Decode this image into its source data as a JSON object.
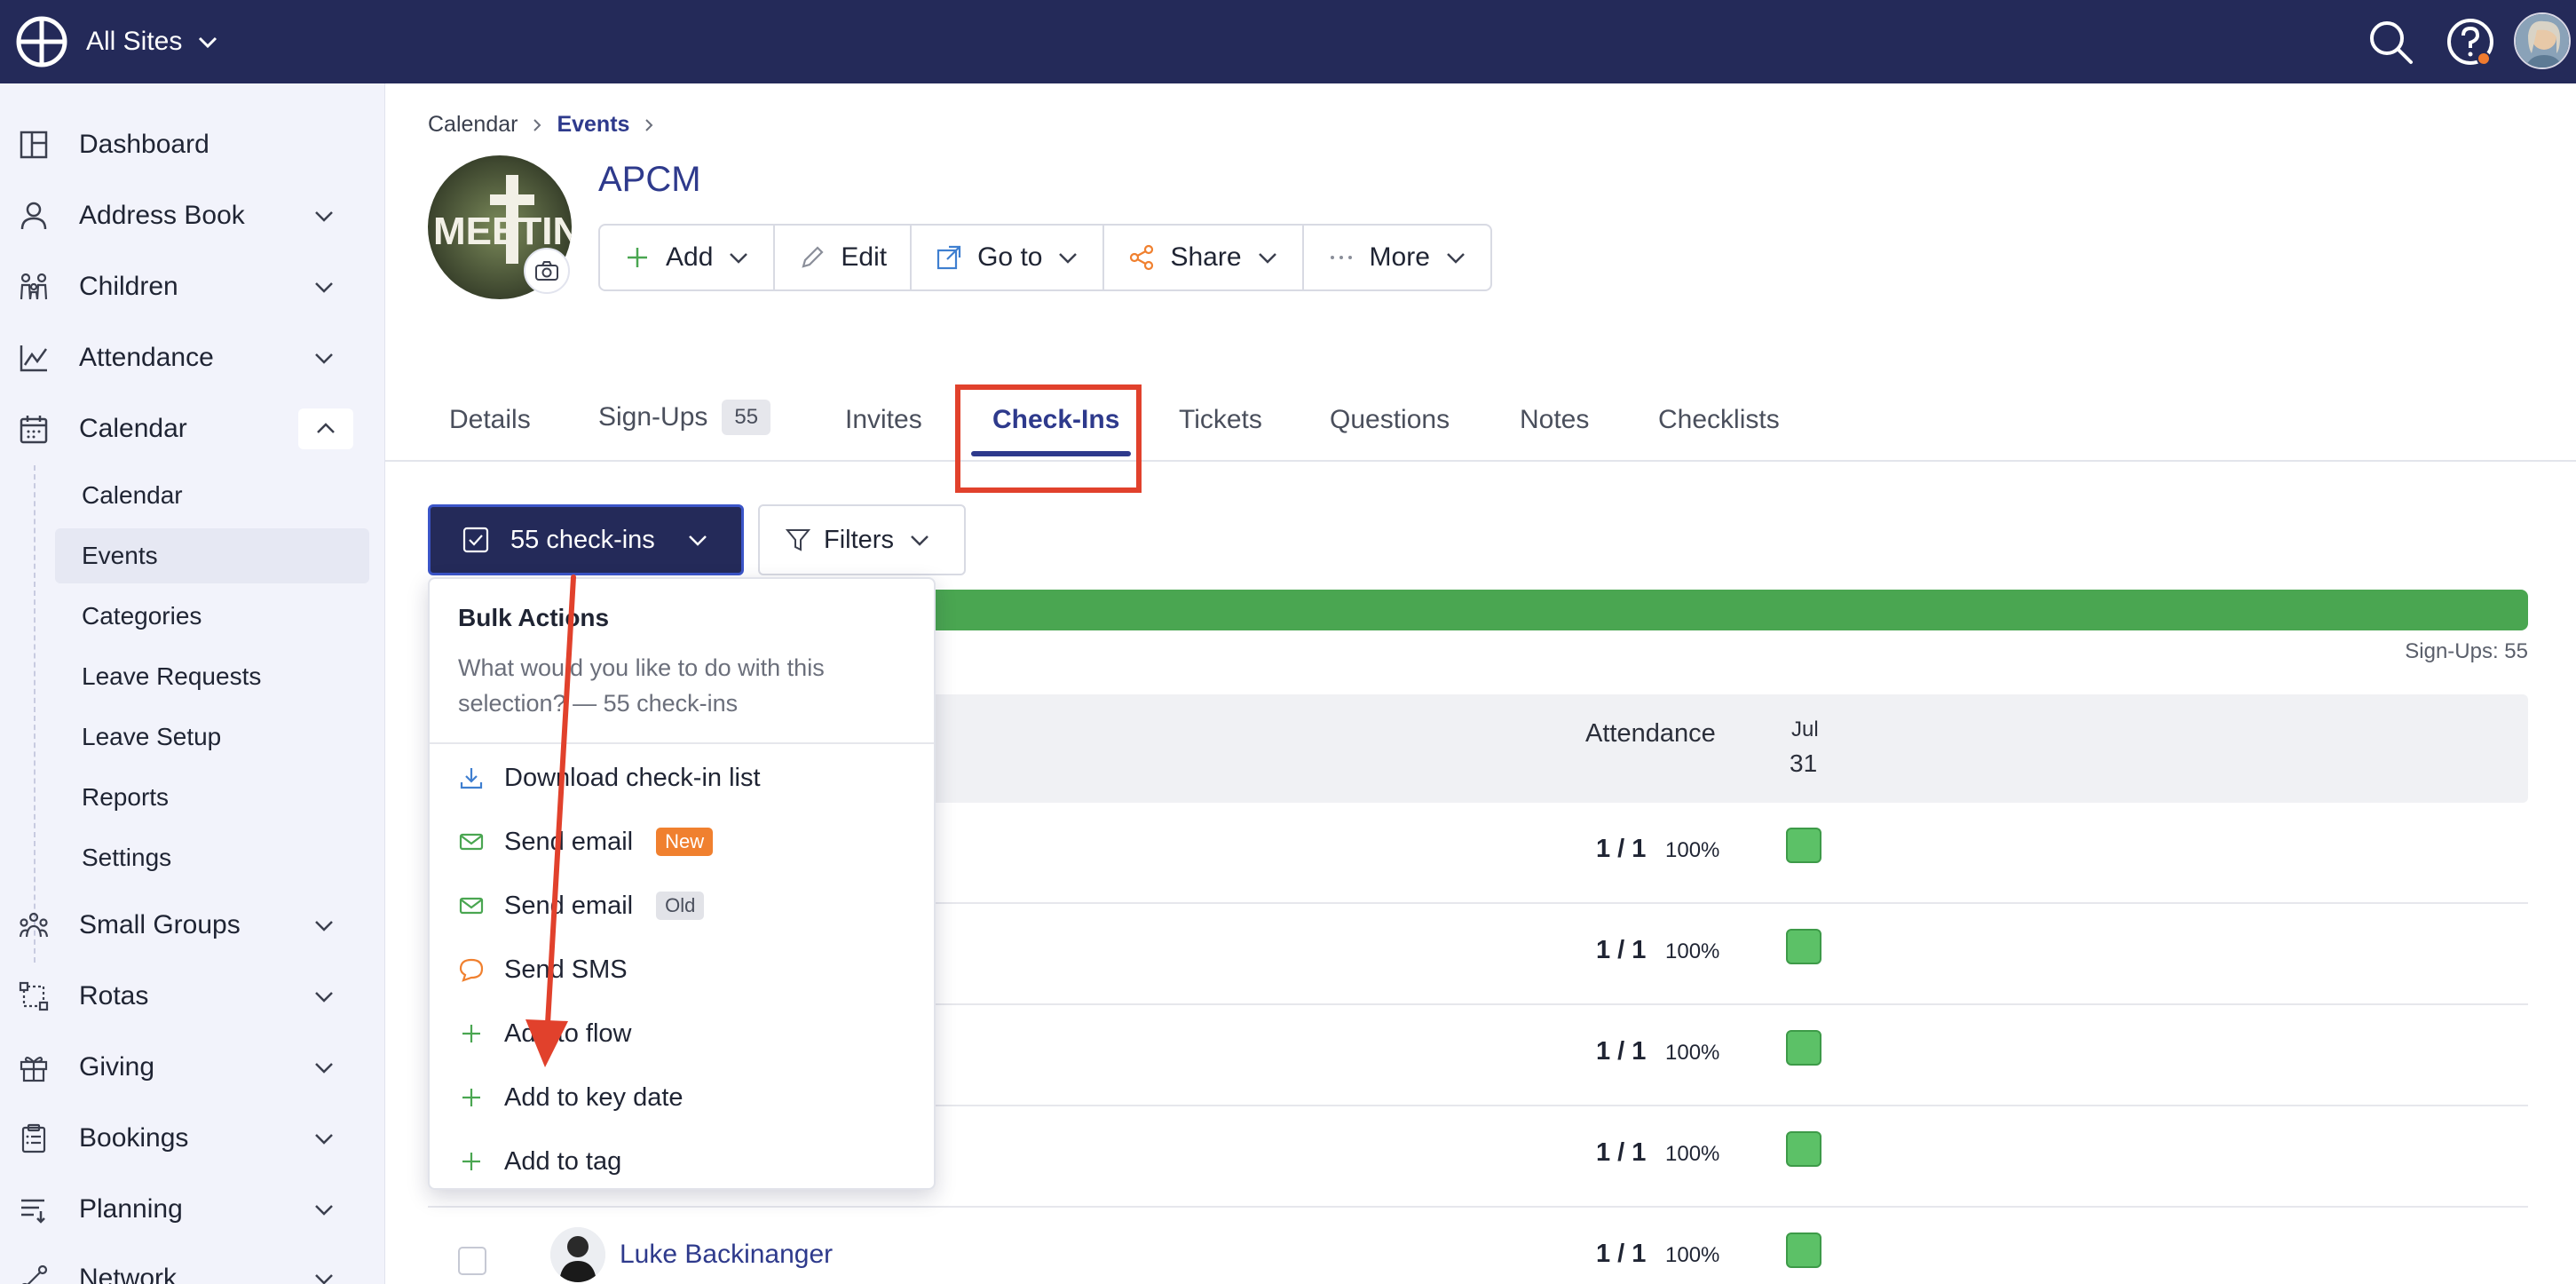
{
  "topbar": {
    "site_switcher": "All Sites",
    "icons": [
      "logo-icon",
      "search-icon",
      "help-icon",
      "avatar"
    ]
  },
  "sidebar": {
    "items": [
      {
        "label": "Dashboard",
        "icon": "dashboard-icon"
      },
      {
        "label": "Address Book",
        "icon": "person-icon"
      },
      {
        "label": "Children",
        "icon": "children-icon"
      },
      {
        "label": "Attendance",
        "icon": "attendance-chart-icon"
      },
      {
        "label": "Calendar",
        "icon": "calendar-icon"
      },
      {
        "label": "Small Groups",
        "icon": "small-groups-icon"
      },
      {
        "label": "Rotas",
        "icon": "rotas-icon"
      },
      {
        "label": "Giving",
        "icon": "gift-icon"
      },
      {
        "label": "Bookings",
        "icon": "clipboard-icon"
      },
      {
        "label": "Planning",
        "icon": "planning-icon"
      },
      {
        "label": "Network",
        "icon": "network-icon"
      }
    ],
    "calendar_sub": [
      "Calendar",
      "Events",
      "Categories",
      "Leave Requests",
      "Leave Setup",
      "Reports",
      "Settings"
    ],
    "active_sub": "Events"
  },
  "breadcrumb": {
    "parent": "Calendar",
    "current": "Events"
  },
  "event": {
    "title": "APCM",
    "image_text": "MEETING"
  },
  "actions": {
    "add": "Add",
    "edit": "Edit",
    "goto": "Go to",
    "share": "Share",
    "more": "More"
  },
  "tabs": {
    "details": "Details",
    "signups": "Sign-Ups",
    "signups_count": "55",
    "invites": "Invites",
    "checkins": "Check-Ins",
    "tickets": "Tickets",
    "questions": "Questions",
    "notes": "Notes",
    "checklists": "Checklists"
  },
  "toolbar": {
    "checkins_label": "55 check-ins",
    "filters_label": "Filters"
  },
  "progress": {
    "fraction": 1.0
  },
  "summary": {
    "signups": "Sign-Ups: 55"
  },
  "table": {
    "col_attendance": "Attendance",
    "date_month": "Jul",
    "date_day": "31",
    "rows": [
      {
        "attendance": "1 / 1",
        "pct": "100%",
        "name": ""
      },
      {
        "attendance": "1 / 1",
        "pct": "100%",
        "name": ""
      },
      {
        "attendance": "1 / 1",
        "pct": "100%",
        "name": ""
      },
      {
        "attendance": "1 / 1",
        "pct": "100%",
        "name": ""
      },
      {
        "attendance": "1 / 1",
        "pct": "100%",
        "name": "Luke Backinanger"
      }
    ]
  },
  "dropdown": {
    "title": "Bulk Actions",
    "description": "What would you like to do with this selection? — 55 check-ins",
    "items": [
      {
        "label": "Download check-in list",
        "icon": "download-icon"
      },
      {
        "label": "Send email",
        "badge": "New",
        "icon": "mail-icon"
      },
      {
        "label": "Send email",
        "badge": "Old",
        "icon": "mail-icon"
      },
      {
        "label": "Send SMS",
        "icon": "chat-bubble-icon"
      },
      {
        "label": "Add to flow",
        "icon": "plus-icon"
      },
      {
        "label": "Add to key date",
        "icon": "plus-icon"
      },
      {
        "label": "Add to tag",
        "icon": "plus-icon"
      }
    ]
  },
  "colors": {
    "brand_navy": "#242a59",
    "accent_blue": "#2e3a8c",
    "success_green": "#4aa651",
    "annotation_red": "#e1412c",
    "badge_orange": "#f0802f"
  }
}
